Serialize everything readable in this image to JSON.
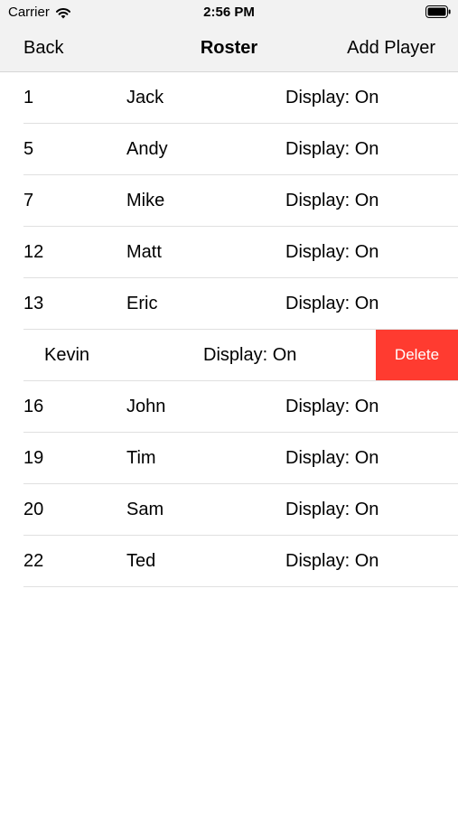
{
  "status_bar": {
    "carrier": "Carrier",
    "time": "2:56 PM",
    "wifi_icon": "wifi-icon",
    "battery_icon": "battery-icon"
  },
  "nav": {
    "back_label": "Back",
    "title": "Roster",
    "add_label": "Add Player"
  },
  "players": [
    {
      "number": "1",
      "name": "Jack",
      "display": "Display: On"
    },
    {
      "number": "5",
      "name": "Andy",
      "display": "Display: On"
    },
    {
      "number": "7",
      "name": "Mike",
      "display": "Display: On"
    },
    {
      "number": "12",
      "name": "Matt",
      "display": "Display: On"
    },
    {
      "number": "13",
      "name": "Eric",
      "display": "Display: On"
    },
    {
      "number": "",
      "name": "Kevin",
      "display": "Display: On",
      "delete_label": "Delete"
    },
    {
      "number": "16",
      "name": "John",
      "display": "Display: On"
    },
    {
      "number": "19",
      "name": "Tim",
      "display": "Display: On"
    },
    {
      "number": "20",
      "name": "Sam",
      "display": "Display: On"
    },
    {
      "number": "22",
      "name": "Ted",
      "display": "Display: On"
    }
  ],
  "colors": {
    "delete": "#ff3b30",
    "bar_background": "#f2f2f2"
  }
}
